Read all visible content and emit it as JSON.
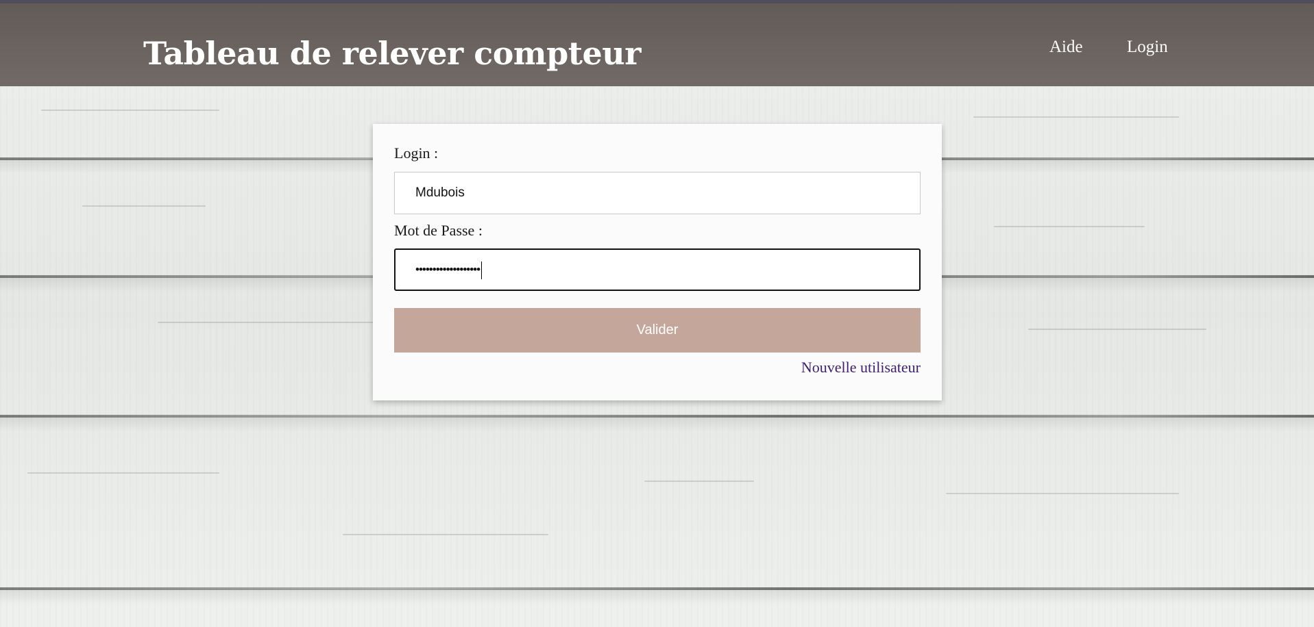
{
  "header": {
    "title": "Tableau de relever compteur",
    "nav": {
      "help_label": "Aide",
      "login_label": "Login"
    }
  },
  "login_form": {
    "login_label": "Login :",
    "login_value": "Mdubois",
    "password_label": "Mot de Passe :",
    "password_value": "•••••••••••••••••••",
    "submit_label": "Valider",
    "new_user_link": "Nouvelle utilisateur"
  },
  "colors": {
    "header_bg": "#6a6360",
    "button_bg": "#c5a69a",
    "link_color": "#3e1f6e"
  }
}
